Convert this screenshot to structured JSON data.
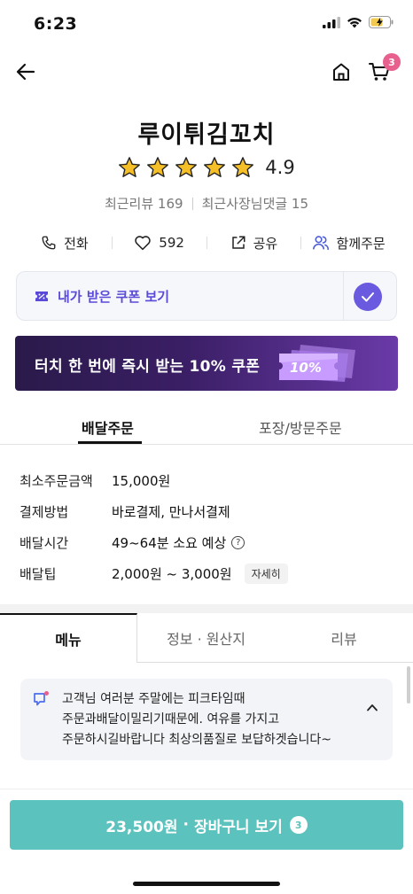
{
  "status_bar": {
    "time": "6:23"
  },
  "nav": {
    "cart_count": "3"
  },
  "store": {
    "name": "루이튀김꼬치",
    "rating": "4.9",
    "rating_stars": 5,
    "recent_reviews": "최근리뷰 169",
    "owner_replies": "최근사장님댓글 15"
  },
  "actions": {
    "call": "전화",
    "likes": "592",
    "share": "공유",
    "group_order": "함께주문"
  },
  "coupon": {
    "label": "내가 받은 쿠폰 보기"
  },
  "banner": {
    "text": "터치 한 번에 즉시 받는 10% 쿠폰",
    "art_text": "10%"
  },
  "order_tabs": {
    "delivery": "배달주문",
    "pickup": "포장/방문주문"
  },
  "info": [
    {
      "label": "최소주문금액",
      "value": "15,000원"
    },
    {
      "label": "결제방법",
      "value": "바로결제, 만나서결제"
    },
    {
      "label": "배달시간",
      "value": "49~64분 소요 예상"
    },
    {
      "label": "배달팁",
      "value": "2,000원 ~ 3,000원",
      "chip": "자세히"
    }
  ],
  "menu_tabs": {
    "menu": "메뉴",
    "info": "정보 · 원산지",
    "review": "리뷰"
  },
  "notice": {
    "lines": [
      "고객님 여러분 주말에는 피크타임때",
      "주문과배달이밀리기때문에. 여유를 가지고",
      "주문하시길바랍니다 최상의품질로 보답하겟습니다~"
    ]
  },
  "cta": {
    "price": "23,500원",
    "dot": "·",
    "label": "장바구니 보기",
    "count": "3"
  },
  "colors": {
    "accent_purple": "#6a5ae0",
    "cta_teal": "#5cc2be",
    "badge_pink": "#e8608d"
  }
}
